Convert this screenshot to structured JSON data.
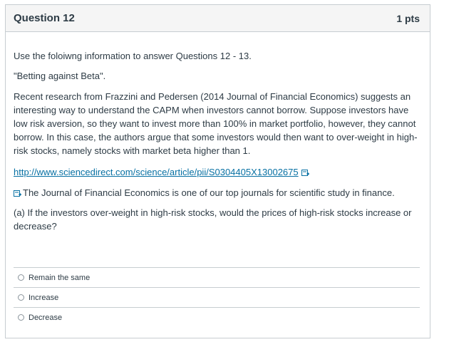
{
  "question": {
    "title": "Question 12",
    "points": "1 pts"
  },
  "content": {
    "intro": "Use the foloiwng information to answer Questions 12 - 13.",
    "quote": "\"Betting against Beta\".",
    "paragraph": "Recent research from Frazzini and Pedersen (2014 Journal of Financial Economics) suggests an interesting way to understand the CAPM when investors cannot borrow. Suppose investors have low risk aversion, so they want to invest more than 100% in market portfolio, however, they cannot borrow. In this case, the authors argue that some investors would then want to over-weight in high-risk stocks, namely stocks with market beta higher than 1.",
    "link_text": "http://www.sciencedirect.com/science/article/pii/S0304405X13002675",
    "journal_note": "The Journal of Financial Economics is one of our top journals for scientific study in finance.",
    "prompt": "(a) If the investors over-weight in high-risk stocks, would the prices of high-risk stocks increase or decrease?"
  },
  "answers": [
    {
      "label": "Remain the same"
    },
    {
      "label": "Increase"
    },
    {
      "label": "Decrease"
    }
  ],
  "colors": {
    "link": "#0770a3",
    "text": "#2d3b45",
    "border": "#c7cdd1",
    "header_bg": "#f5f5f5"
  }
}
